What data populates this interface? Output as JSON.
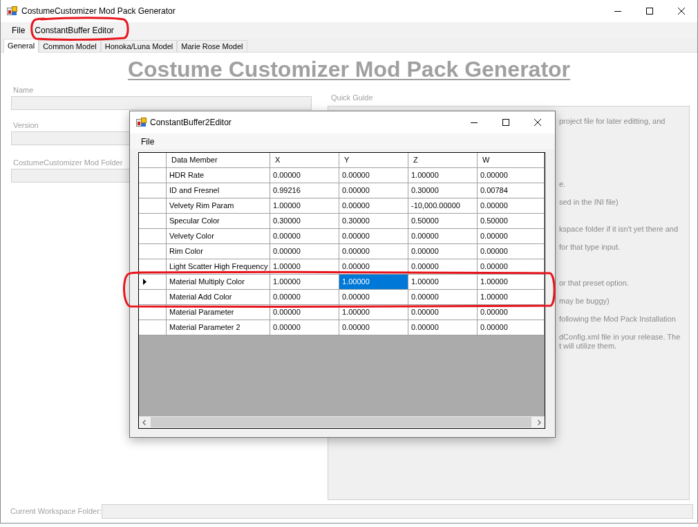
{
  "window": {
    "title": "CostumeCustomizer Mod Pack Generator"
  },
  "menu": [
    {
      "label": "File"
    },
    {
      "label": "ConstantBuffer Editor"
    }
  ],
  "tabs": [
    {
      "label": "General",
      "selected": true
    },
    {
      "label": "Common Model",
      "selected": false
    },
    {
      "label": "Honoka/Luna Model",
      "selected": false
    },
    {
      "label": "Marie Rose Model",
      "selected": false
    }
  ],
  "general": {
    "heading": "Costume Customizer Mod Pack Generator",
    "fields": [
      {
        "label": "Name"
      },
      {
        "label": "Version"
      },
      {
        "label": "CostumeCustomizer Mod Folder"
      }
    ],
    "quick_guide": {
      "label": "Quick Guide",
      "lines": [
        "project file for later editting, and",
        "e.",
        "sed in the INI file)",
        "kspace folder if it isn't yet there and",
        "for that type input.",
        "or that preset option.",
        "may be buggy)",
        "following the Mod Pack Installation",
        "dConfig.xml file in your release. The",
        "t will utilize them."
      ]
    },
    "workspace": {
      "label": "Current Workspace Folder:"
    }
  },
  "dialog": {
    "title": "ConstantBuffer2Editor",
    "menu": [
      {
        "label": "File"
      }
    ],
    "grid": {
      "columns": [
        "Data Member",
        "X",
        "Y",
        "Z",
        "W"
      ],
      "rows": [
        {
          "selected": false,
          "cells": [
            {
              "text": "HDR Rate",
              "selected": false
            },
            {
              "text": "0.00000",
              "selected": false
            },
            {
              "text": "0.00000",
              "selected": false
            },
            {
              "text": "1.00000",
              "selected": false
            },
            {
              "text": "0.00000",
              "selected": false
            }
          ]
        },
        {
          "selected": false,
          "cells": [
            {
              "text": "ID and Fresnel",
              "selected": false
            },
            {
              "text": "0.99216",
              "selected": false
            },
            {
              "text": "0.00000",
              "selected": false
            },
            {
              "text": "0.30000",
              "selected": false
            },
            {
              "text": "0.00784",
              "selected": false
            }
          ]
        },
        {
          "selected": false,
          "cells": [
            {
              "text": "Velvety Rim Param",
              "selected": false
            },
            {
              "text": "1.00000",
              "selected": false
            },
            {
              "text": "0.00000",
              "selected": false
            },
            {
              "text": "-10,000.00000",
              "selected": false
            },
            {
              "text": "0.00000",
              "selected": false
            }
          ]
        },
        {
          "selected": false,
          "cells": [
            {
              "text": "Specular Color",
              "selected": false
            },
            {
              "text": "0.30000",
              "selected": false
            },
            {
              "text": "0.30000",
              "selected": false
            },
            {
              "text": "0.50000",
              "selected": false
            },
            {
              "text": "0.50000",
              "selected": false
            }
          ]
        },
        {
          "selected": false,
          "cells": [
            {
              "text": "Velvety Color",
              "selected": false
            },
            {
              "text": "0.00000",
              "selected": false
            },
            {
              "text": "0.00000",
              "selected": false
            },
            {
              "text": "0.00000",
              "selected": false
            },
            {
              "text": "0.00000",
              "selected": false
            }
          ]
        },
        {
          "selected": false,
          "cells": [
            {
              "text": "Rim Color",
              "selected": false
            },
            {
              "text": "0.00000",
              "selected": false
            },
            {
              "text": "0.00000",
              "selected": false
            },
            {
              "text": "0.00000",
              "selected": false
            },
            {
              "text": "0.00000",
              "selected": false
            }
          ]
        },
        {
          "selected": false,
          "cells": [
            {
              "text": "Light Scatter High Frequency",
              "selected": false
            },
            {
              "text": "1.00000",
              "selected": false
            },
            {
              "text": "0.00000",
              "selected": false
            },
            {
              "text": "0.00000",
              "selected": false
            },
            {
              "text": "0.00000",
              "selected": false
            }
          ]
        },
        {
          "selected": true,
          "cells": [
            {
              "text": "Material Multiply Color",
              "selected": false
            },
            {
              "text": "1.00000",
              "selected": false
            },
            {
              "text": "1.00000",
              "selected": true
            },
            {
              "text": "1.00000",
              "selected": false
            },
            {
              "text": "1.00000",
              "selected": false
            }
          ]
        },
        {
          "selected": false,
          "cells": [
            {
              "text": "Material Add Color",
              "selected": false
            },
            {
              "text": "0.00000",
              "selected": false
            },
            {
              "text": "0.00000",
              "selected": false
            },
            {
              "text": "0.00000",
              "selected": false
            },
            {
              "text": "1.00000",
              "selected": false
            }
          ]
        },
        {
          "selected": false,
          "cells": [
            {
              "text": "Material Parameter",
              "selected": false
            },
            {
              "text": "0.00000",
              "selected": false
            },
            {
              "text": "1.00000",
              "selected": false
            },
            {
              "text": "0.00000",
              "selected": false
            },
            {
              "text": "0.00000",
              "selected": false
            }
          ]
        },
        {
          "selected": false,
          "cells": [
            {
              "text": "Material Parameter 2",
              "selected": false
            },
            {
              "text": "0.00000",
              "selected": false
            },
            {
              "text": "0.00000",
              "selected": false
            },
            {
              "text": "0.00000",
              "selected": false
            },
            {
              "text": "0.00000",
              "selected": false
            }
          ]
        }
      ]
    }
  },
  "annotations": [
    {
      "kind": "loop"
    },
    {
      "kind": "loop"
    }
  ]
}
